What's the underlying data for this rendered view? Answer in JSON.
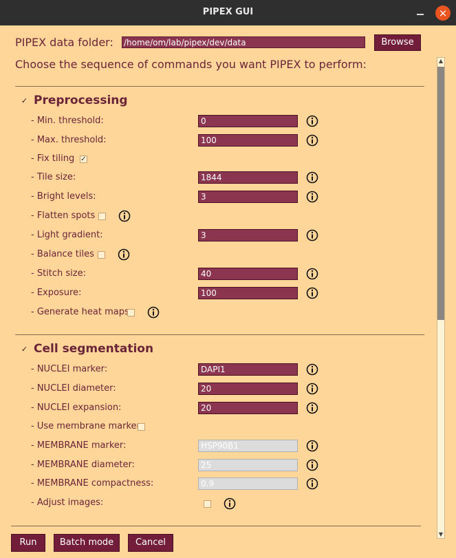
{
  "window": {
    "title": "PIPEX GUI",
    "close_glyph": "×"
  },
  "header": {
    "folder_label": "PIPEX data folder:",
    "folder_value": "/home/om/lab/pipex/dev/data",
    "browse_label": "Browse",
    "instructions": "Choose the sequence of commands you want PIPEX to perform:"
  },
  "preprocessing": {
    "title": "Preprocessing",
    "enabled": true,
    "min_threshold": {
      "label": "- Min. threshold:",
      "value": "0"
    },
    "max_threshold": {
      "label": "- Max. threshold:",
      "value": "100"
    },
    "fix_tiling": {
      "label": "- Fix tiling",
      "checked": true
    },
    "tile_size": {
      "label": "- Tile size:",
      "value": "1844"
    },
    "bright_levels": {
      "label": "- Bright levels:",
      "value": "3"
    },
    "flatten_spots": {
      "label": "- Flatten spots",
      "checked": false
    },
    "light_gradient": {
      "label": "- Light gradient:",
      "value": "3"
    },
    "balance_tiles": {
      "label": "- Balance tiles",
      "checked": false
    },
    "stitch_size": {
      "label": "- Stitch size:",
      "value": "40"
    },
    "exposure": {
      "label": "- Exposure:",
      "value": "100"
    },
    "generate_heat_maps": {
      "label": "- Generate heat maps",
      "checked": false
    }
  },
  "segmentation": {
    "title": "Cell segmentation",
    "enabled": true,
    "nuclei_marker": {
      "label": "- NUCLEI marker:",
      "value": "DAPI1"
    },
    "nuclei_diameter": {
      "label": "- NUCLEI diameter:",
      "value": "20"
    },
    "nuclei_expansion": {
      "label": "- NUCLEI expansion:",
      "value": "20"
    },
    "use_membrane_marker": {
      "label": "- Use membrane marker",
      "checked": false
    },
    "membrane_marker": {
      "label": "- MEMBRANE marker:",
      "value": "HSP90B1"
    },
    "membrane_diameter": {
      "label": "- MEMBRANE diameter:",
      "value": "25"
    },
    "membrane_compactness": {
      "label": "- MEMBRANE compactness:",
      "value": "0.9"
    },
    "adjust_images": {
      "label": "- Adjust images:",
      "checked": false
    }
  },
  "footer": {
    "run_label": "Run",
    "batch_label": "Batch mode",
    "cancel_label": "Cancel"
  },
  "glyphs": {
    "checkmark": "✓",
    "up_arrow": "▲",
    "down_arrow": "▼"
  },
  "colors": {
    "background": "#ffd699",
    "accent": "#721d3a",
    "field": "#8c3550",
    "label": "#6b2438",
    "titlebar": "#2f2f2f",
    "close": "#e95420"
  }
}
